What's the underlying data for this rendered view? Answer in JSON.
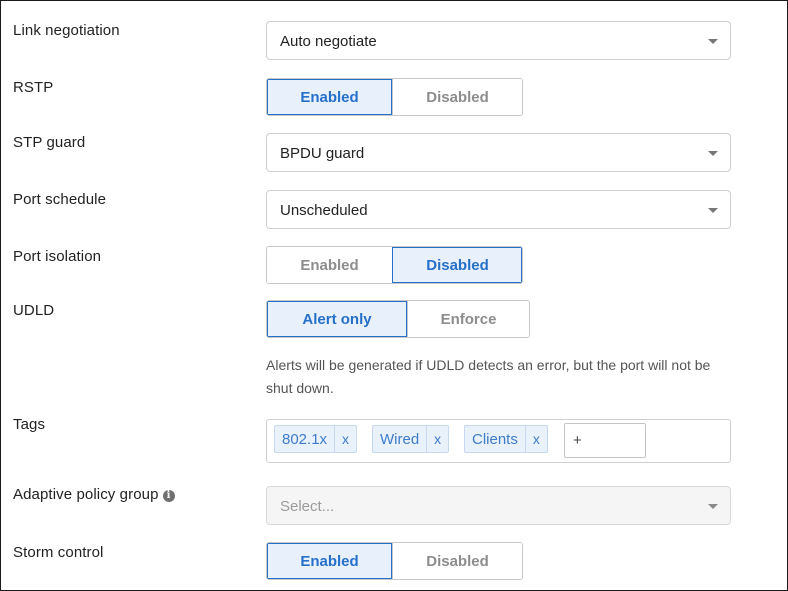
{
  "link_negotiation": {
    "label": "Link negotiation",
    "value": "Auto negotiate"
  },
  "rstp": {
    "label": "RSTP",
    "options": [
      "Enabled",
      "Disabled"
    ],
    "selected": "Enabled"
  },
  "stp_guard": {
    "label": "STP guard",
    "value": "BPDU guard"
  },
  "port_schedule": {
    "label": "Port schedule",
    "value": "Unscheduled"
  },
  "port_isolation": {
    "label": "Port isolation",
    "options": [
      "Enabled",
      "Disabled"
    ],
    "selected": "Disabled"
  },
  "udld": {
    "label": "UDLD",
    "options": [
      "Alert only",
      "Enforce"
    ],
    "selected": "Alert only",
    "help_line1": "Alerts will be generated if UDLD detects an error, but the port will not be",
    "help_line2": "shut down."
  },
  "tags": {
    "label": "Tags",
    "items": [
      "802.1x",
      "Wired",
      "Clients"
    ],
    "remove_glyph": "x",
    "add_placeholder": "+"
  },
  "adaptive_policy_group": {
    "label": "Adaptive policy group",
    "placeholder": "Select...",
    "info_glyph": "i"
  },
  "storm_control": {
    "label": "Storm control",
    "options": [
      "Enabled",
      "Disabled"
    ],
    "selected": "Enabled"
  },
  "colors": {
    "accent": "#2670c9",
    "active_bg": "#e7f0fb",
    "tag_bg": "#e9f1fb"
  },
  "icons": {
    "dropdown": "chevron-down-icon",
    "info": "info-icon",
    "remove": "close-icon"
  }
}
